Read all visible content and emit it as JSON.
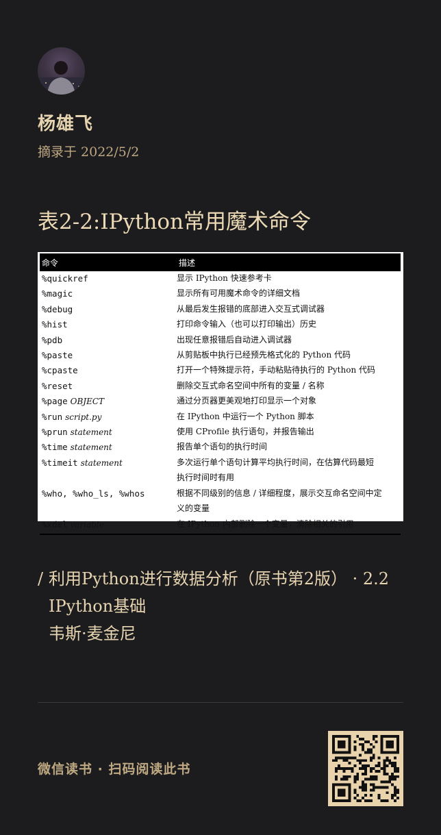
{
  "user": {
    "name": "杨雄飞",
    "date": "摘录于 2022/5/2"
  },
  "excerpt": {
    "title": "表2-2:IPython常用魔术命令"
  },
  "table": {
    "headers": [
      "命令",
      "描述"
    ],
    "rows": [
      {
        "cmd": "%quickref",
        "arg": "",
        "desc": "显示 IPython 快速参考卡"
      },
      {
        "cmd": "%magic",
        "arg": "",
        "desc": "显示所有可用魔术命令的详细文档"
      },
      {
        "cmd": "%debug",
        "arg": "",
        "desc": "从最后发生报错的底部进入交互式调试器"
      },
      {
        "cmd": "%hist",
        "arg": "",
        "desc": "打印命令输入（也可以打印输出）历史"
      },
      {
        "cmd": "%pdb",
        "arg": "",
        "desc": "出现任意报错后自动进入调试器"
      },
      {
        "cmd": "%paste",
        "arg": "",
        "desc": "从剪贴板中执行已经预先格式化的 Python 代码"
      },
      {
        "cmd": "%cpaste",
        "arg": "",
        "desc": "打开一个特殊提示符，手动粘贴待执行的 Python 代码"
      },
      {
        "cmd": "%reset",
        "arg": "",
        "desc": "删除交互式命名空间中所有的变量 / 名称"
      },
      {
        "cmd": "%page",
        "arg": "OBJECT",
        "desc": "通过分页器更美观地打印显示一个对象"
      },
      {
        "cmd": "%run",
        "arg": "script.py",
        "desc": "在 IPython 中运行一个 Python 脚本"
      },
      {
        "cmd": "%prun",
        "arg": "statement",
        "desc": "使用 CProfile 执行语句，并报告输出"
      },
      {
        "cmd": "%time",
        "arg": "statement",
        "desc": "报告单个语句的执行时间"
      },
      {
        "cmd": "%timeit",
        "arg": "statement",
        "desc": "多次运行单个语句计算平均执行时间，在估算代码最短"
      },
      {
        "cmd": "",
        "arg": "",
        "desc": "执行时间时有用"
      },
      {
        "cmd": "%who, %who_ls, %whos",
        "arg": "",
        "desc": "根据不同级别的信息 / 详细程度，展示交互命名空间中定"
      },
      {
        "cmd": "",
        "arg": "",
        "desc": "义的变量"
      },
      {
        "cmd": "%xdel",
        "arg": "variable",
        "desc": "在 IPython 内部删除一个变量，清除相关的引用"
      }
    ]
  },
  "source": {
    "slash": "/",
    "book_line1": "利用Python进行数据分析（原书第2版） · 2.2",
    "book_line2": "IPython基础",
    "author": "韦斯·麦金尼"
  },
  "footer": {
    "text": "微信读书 · 扫码阅读此书"
  },
  "colors": {
    "background": "#1c1c1e",
    "accent": "#e6d3b0",
    "muted": "#bfa983",
    "qr_bg": "#e9d3ad"
  }
}
